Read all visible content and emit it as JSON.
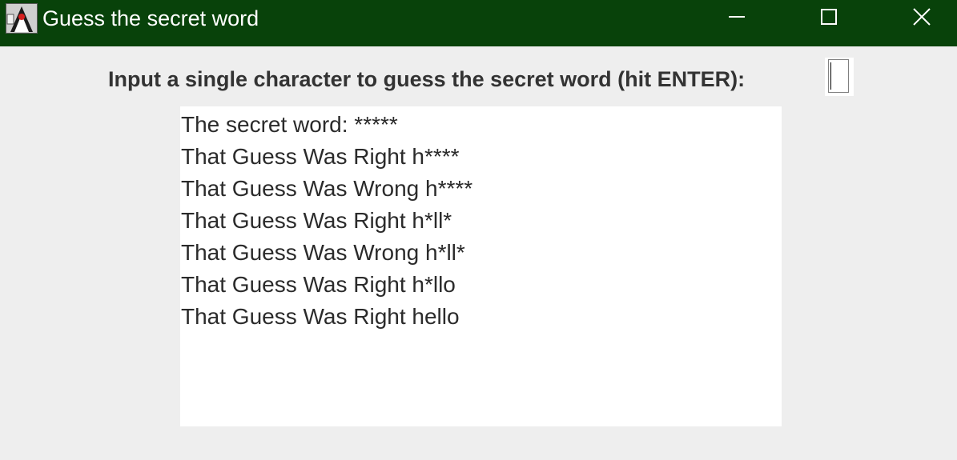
{
  "window": {
    "title": "Guess the secret word",
    "titlebar_color": "#08420a",
    "icon": "java-duke-icon"
  },
  "controls": {
    "minimize_icon": "minimize-icon",
    "maximize_icon": "maximize-icon",
    "close_icon": "close-icon"
  },
  "prompt": {
    "label": "Input a single character to guess the secret word (hit ENTER):",
    "input_value": ""
  },
  "log": {
    "lines": [
      "The secret word: *****",
      "That Guess Was Right h****",
      "That Guess Was Wrong h****",
      "That Guess Was Right h*ll*",
      "That Guess Was Wrong h*ll*",
      "That Guess Was Right h*llo",
      "That Guess Was Right hello"
    ]
  }
}
